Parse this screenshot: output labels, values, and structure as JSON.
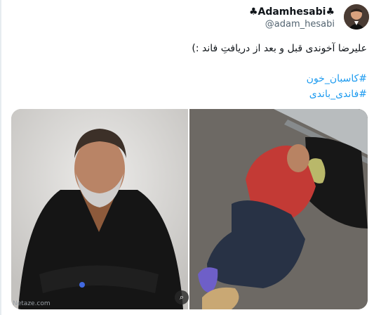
{
  "author": {
    "display_name": "♣Adamhesabi♣",
    "handle": "@adam_hesabi",
    "avatar_icon": "avatar"
  },
  "tweet": {
    "text": "علیرضا آخوندی قبل و بعد از دریافتِ فاند :)",
    "hashtags": [
      "#کاسبان_خون",
      "#فاندی_باندی"
    ]
  },
  "media": {
    "left_watermark": "Netaze.com",
    "lens_icon": "image-search-icon"
  },
  "colors": {
    "link": "#1d9bf0",
    "text": "#0f1419",
    "secondary": "#536471"
  }
}
